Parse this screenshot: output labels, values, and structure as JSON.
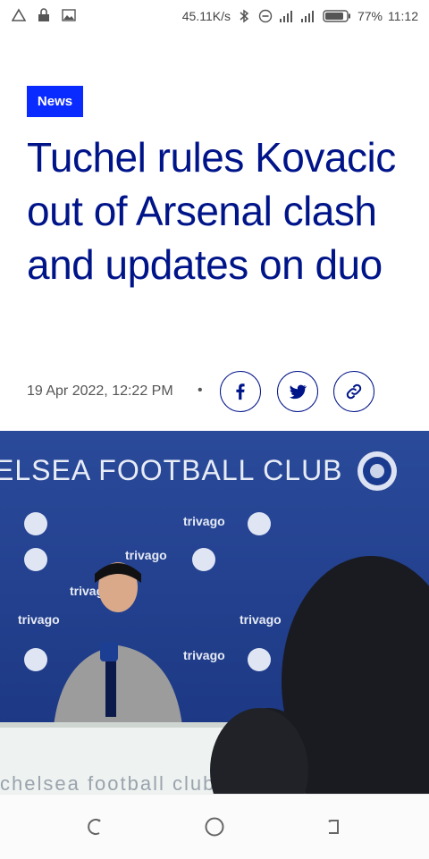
{
  "status_bar": {
    "network_speed": "45.11K/s",
    "battery_percent": "77%",
    "time": "11:12",
    "left_icons": [
      "warning-icon",
      "lock-icon",
      "image-icon"
    ],
    "right_icons": [
      "bluetooth-icon",
      "dnd-icon",
      "signal-icon",
      "signal-icon",
      "battery-icon"
    ]
  },
  "article": {
    "category": "News",
    "headline": "Tuchel rules Kovacic out of Arsenal clash and updates on duo",
    "date": "19 Apr 2022, 12:22 PM",
    "separator": "•",
    "share_buttons": [
      "facebook-icon",
      "twitter-icon",
      "link-icon"
    ]
  },
  "photo": {
    "backdrop_title": "ELSEA FOOTBALL CLUB",
    "sponsor": "trivago",
    "floor_text": "chelsea football club"
  },
  "nav_bar": {
    "buttons": [
      "back-icon",
      "home-icon",
      "recents-icon"
    ]
  },
  "colors": {
    "accent": "#0a2bff",
    "headline": "#001489",
    "backdrop": "#1f3d8e"
  }
}
